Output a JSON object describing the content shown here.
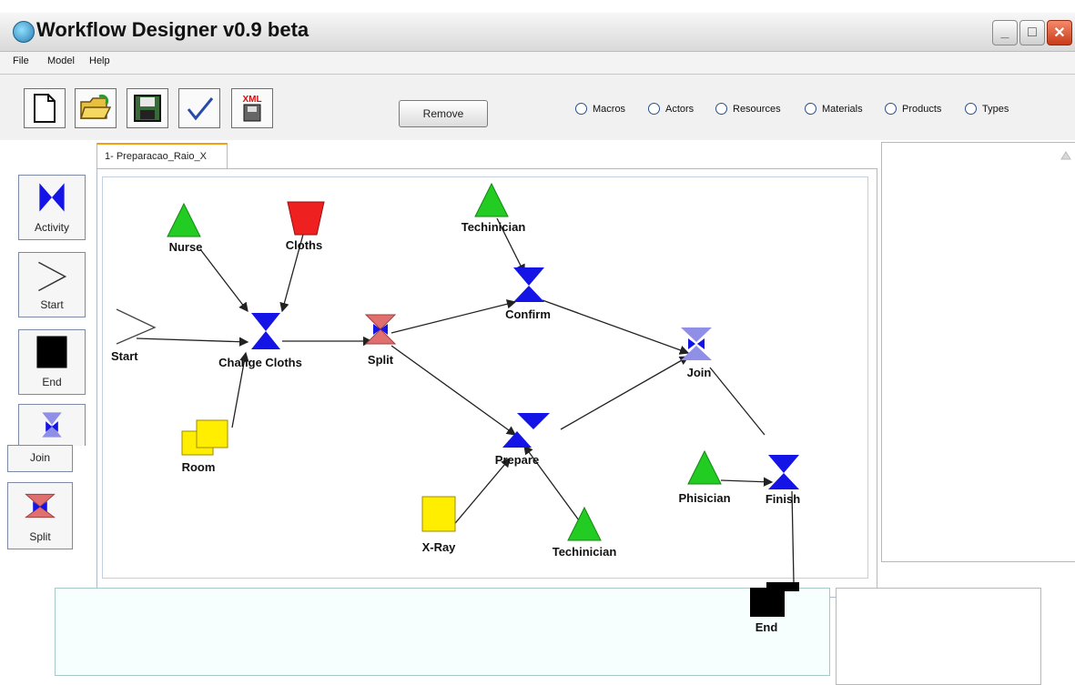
{
  "window": {
    "title": "Workflow Designer v0.9 beta"
  },
  "menu": [
    "File",
    "Model",
    "Help"
  ],
  "toolbar": {
    "remove_label": "Remove",
    "xml_icon_text": "XML",
    "radios": [
      "Macros",
      "Actors",
      "Resources",
      "Materials",
      "Products",
      "Types"
    ]
  },
  "palette": {
    "activity": "Activity",
    "start": "Start",
    "end": "End",
    "join": "Join",
    "split": "Split"
  },
  "tab": {
    "label": "1- Preparacao_Raio_X"
  },
  "diagram": {
    "nodes": {
      "nurse": "Nurse",
      "cloths": "Cloths",
      "start": "Start",
      "change_cloths": "Change Cloths",
      "room": "Room",
      "split": "Split",
      "technician_top": "Techinician",
      "confirm": "Confirm",
      "join": "Join",
      "prepare": "Prepare",
      "xray": "X-Ray",
      "technician_bottom": "Techinician",
      "physician": "Phisician",
      "finish": "Finish",
      "end": "End"
    }
  },
  "colors": {
    "activity_blue": "#1414e6",
    "actor_green": "#22cc22",
    "resource_red": "#ee2020",
    "material_yellow": "#ffee00",
    "split_red": "#e07070",
    "join_lilac": "#8f8fe8"
  }
}
